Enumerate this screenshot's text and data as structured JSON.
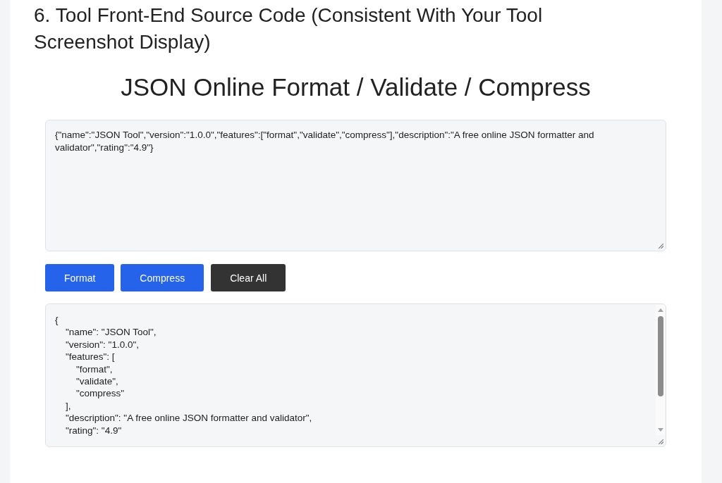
{
  "section_heading": "6. Tool Front-End Source Code (Consistent With Your Tool Screenshot Display)",
  "tool": {
    "title": "JSON Online Format / Validate / Compress",
    "input": {
      "value": "{\"name\":\"JSON Tool\",\"version\":\"1.0.0\",\"features\":[\"format\",\"validate\",\"compress\"],\"description\":\"A free online JSON formatter and validator\",\"rating\":\"4.9\"}"
    },
    "buttons": [
      {
        "label": "Format",
        "kind": "primary"
      },
      {
        "label": "Compress",
        "kind": "primary"
      },
      {
        "label": "Clear All",
        "kind": "secondary"
      }
    ],
    "output": {
      "value": "{\n    \"name\": \"JSON Tool\",\n    \"version\": \"1.0.0\",\n    \"features\": [\n        \"format\",\n        \"validate\",\n        \"compress\"\n    ],\n    \"description\": \"A free online JSON formatter and validator\",\n    \"rating\": \"4.9\""
    }
  }
}
